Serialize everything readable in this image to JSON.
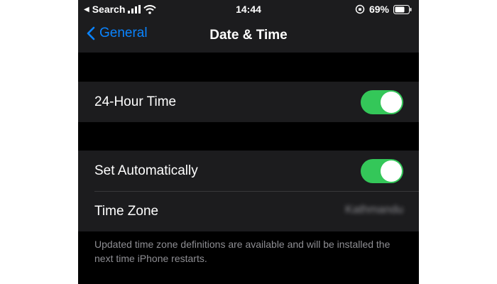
{
  "status_bar": {
    "back_label": "Search",
    "time": "14:44",
    "battery": "69%"
  },
  "nav": {
    "back_label": "General",
    "title": "Date & Time"
  },
  "group1": {
    "hour24": {
      "label": "24-Hour Time",
      "enabled": true
    }
  },
  "group2": {
    "set_automatically": {
      "label": "Set Automatically",
      "enabled": true
    },
    "time_zone": {
      "label": "Time Zone",
      "value": "Kathmandu"
    }
  },
  "footer_note": "Updated time zone definitions are available and will be installed the next time iPhone restarts.",
  "colors": {
    "accent": "#0a84ff",
    "toggle_on": "#34c759",
    "cell_bg": "#1c1c1e",
    "secondary_text": "#8e8e93"
  }
}
